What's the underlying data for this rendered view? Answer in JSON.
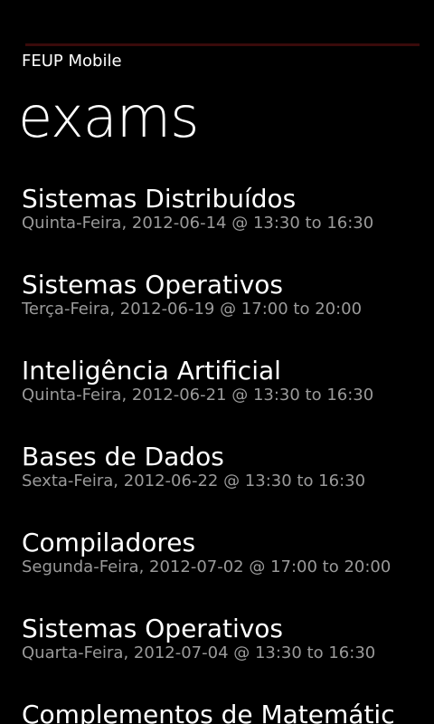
{
  "app": {
    "title": "FEUP Mobile",
    "page_title": "exams"
  },
  "colors": {
    "background": "#000000",
    "primary_text": "#ffffff",
    "secondary_text": "#9a9a9a",
    "accent_line": "#3a0a0a"
  },
  "exams": [
    {
      "name": "Sistemas Distribuídos",
      "when": "Quinta-Feira, 2012-06-14 @ 13:30 to 16:30"
    },
    {
      "name": "Sistemas Operativos",
      "when": "Terça-Feira, 2012-06-19 @ 17:00 to 20:00"
    },
    {
      "name": "Inteligência Artificial",
      "when": "Quinta-Feira, 2012-06-21 @ 13:30 to 16:30"
    },
    {
      "name": "Bases de Dados",
      "when": "Sexta-Feira, 2012-06-22 @ 13:30 to 16:30"
    },
    {
      "name": "Compiladores",
      "when": "Segunda-Feira, 2012-07-02 @ 17:00 to 20:00"
    },
    {
      "name": "Sistemas Operativos",
      "when": "Quarta-Feira, 2012-07-04 @ 13:30 to 16:30"
    },
    {
      "name": "Complementos de Matemátic",
      "when": ""
    }
  ]
}
